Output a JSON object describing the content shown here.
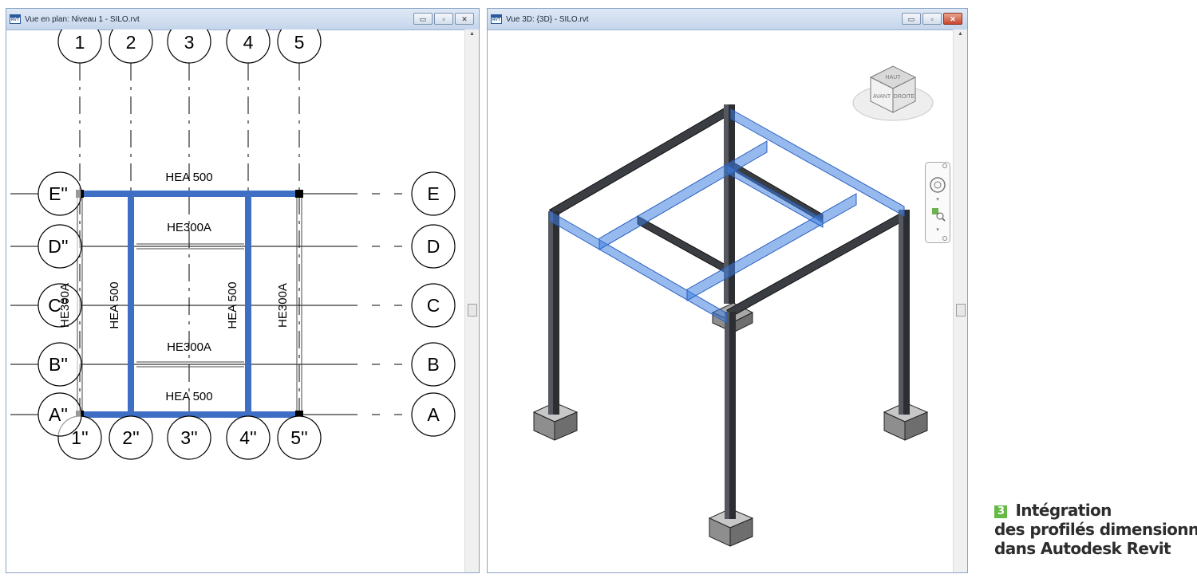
{
  "left_window": {
    "title": "Vue en plan: Niveau 1 - SILO.rvt",
    "icon_label": "RVT",
    "buttons": {
      "minimize": "▭",
      "restore": "▫",
      "close": "✕"
    },
    "grid_top": [
      "1",
      "2",
      "3",
      "4",
      "5"
    ],
    "grid_bottom": [
      "1''",
      "2''",
      "3''",
      "4''",
      "5''"
    ],
    "grid_left": [
      "E''",
      "D''",
      "C''",
      "B''",
      "A''"
    ],
    "grid_right": [
      "E",
      "D",
      "C",
      "B",
      "A"
    ],
    "beams": {
      "top": "HEA 500",
      "upper_secondary": "HE300A",
      "lower_secondary": "HE300A",
      "bottom": "HEA 500",
      "left_vertical": "HEA 500",
      "right_vertical": "HEA 500",
      "left_edge": "HE300A",
      "right_edge": "HE300A"
    },
    "colors": {
      "beam": "#3f6fc4",
      "line": "#000000"
    }
  },
  "right_window": {
    "title": "Vue 3D: {3D} - SILO.rvt",
    "icon_label": "RVT",
    "buttons": {
      "minimize": "▭",
      "restore": "▫",
      "close": "✕"
    },
    "viewcube": {
      "top": "HAUT",
      "front": "AVANT",
      "right": "DROITE"
    },
    "colors": {
      "steel": "#3a3d42",
      "highlight": "#3f7fe0",
      "concrete": "#8d8d8d"
    }
  },
  "caption": {
    "number": "3",
    "line1": "Intégration",
    "line2": "des profilés dimensionnés",
    "line3": "dans Autodesk Revit"
  }
}
